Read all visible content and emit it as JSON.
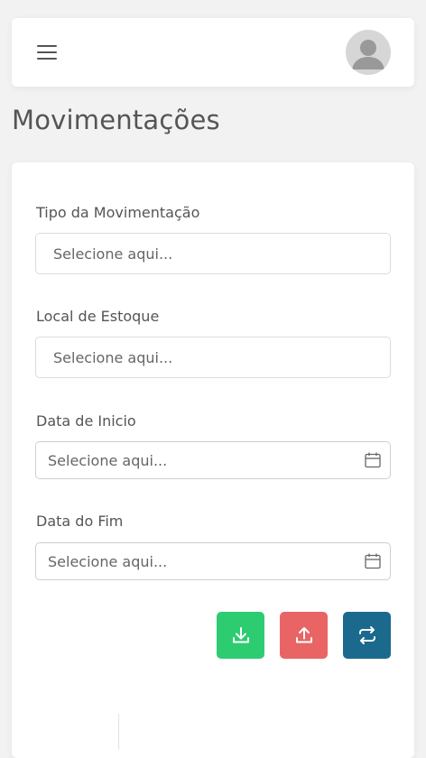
{
  "header": {
    "menu_icon": "hamburger-icon",
    "avatar_icon": "user-avatar-icon"
  },
  "page": {
    "title": "Movimentações"
  },
  "form": {
    "tipo": {
      "label": "Tipo da Movimentação",
      "placeholder": "Selecione aqui..."
    },
    "local": {
      "label": "Local de Estoque",
      "placeholder": "Selecione aqui..."
    },
    "data_inicio": {
      "label": "Data de Inicio",
      "placeholder": "Selecione aqui...",
      "icon": "calendar-icon"
    },
    "data_fim": {
      "label": "Data do Fim",
      "placeholder": "Selecione aqui...",
      "icon": "calendar-icon"
    }
  },
  "actions": {
    "entrada": {
      "icon": "download-icon",
      "color": "#2ecc71"
    },
    "saida": {
      "icon": "upload-icon",
      "color": "#e96565"
    },
    "transferencia": {
      "icon": "transfer-icon",
      "color": "#1b6a8e"
    }
  }
}
